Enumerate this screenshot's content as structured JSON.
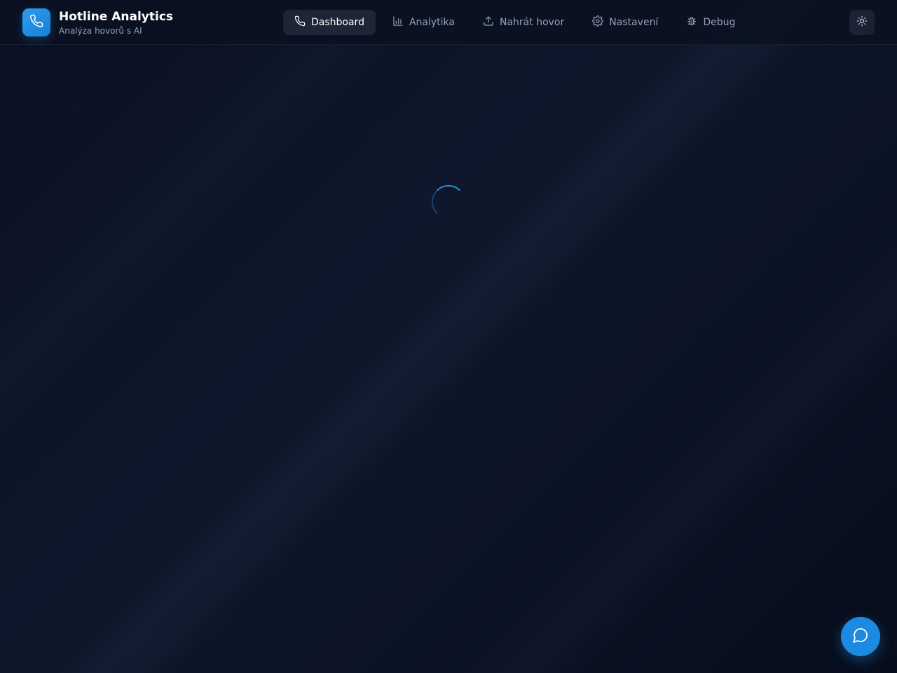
{
  "app": {
    "title": "Hotline Analytics",
    "subtitle": "Analýza hovorů s AI",
    "logo_icon": "phone-icon"
  },
  "nav": {
    "items": [
      {
        "label": "Dashboard",
        "icon": "phone-icon",
        "active": true
      },
      {
        "label": "Analytika",
        "icon": "bar-chart-icon",
        "active": false
      },
      {
        "label": "Nahrát hovor",
        "icon": "upload-icon",
        "active": false
      },
      {
        "label": "Nastavení",
        "icon": "gear-icon",
        "active": false
      },
      {
        "label": "Debug",
        "icon": "bug-icon",
        "active": false
      }
    ]
  },
  "header_actions": {
    "theme_toggle_icon": "sun-icon"
  },
  "main": {
    "state": "loading",
    "indicator_icon": "loading-spinner"
  },
  "chat": {
    "icon": "chat-bubble-icon"
  },
  "colors": {
    "accent": "#1c8ae0",
    "background": "#0b1326",
    "text_muted": "#94a3b8"
  }
}
